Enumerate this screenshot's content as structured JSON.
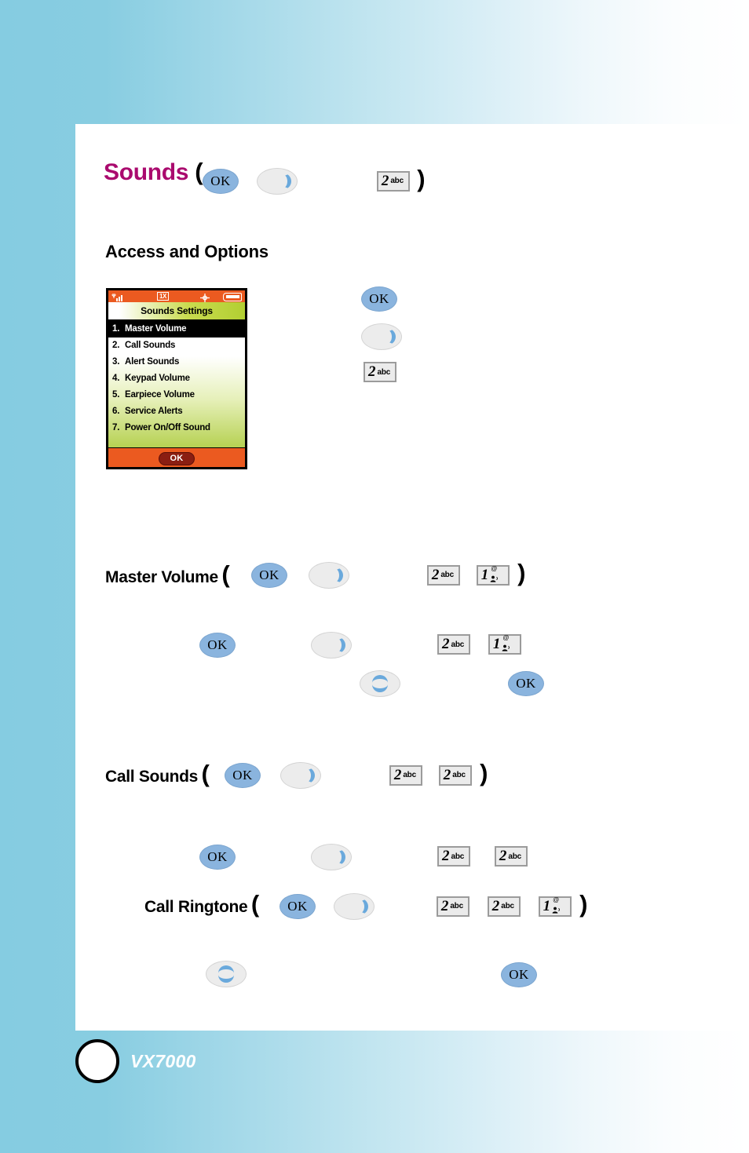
{
  "page": {
    "model": "VX7000",
    "page_badge": "",
    "brand_accent": "#aa0a6e",
    "background_accent": "#85cce1"
  },
  "section": {
    "title": "Sounds",
    "open_paren": "(",
    "close_paren": ")",
    "subtitle": "Access and Options"
  },
  "keys": {
    "ok": "OK",
    "nav_right": "nav-right-key",
    "nav_updown": "nav-up-down-key",
    "key2_digit": "2",
    "key2_letters": "abc",
    "key1_digit": "1",
    "key1_symbol": "@"
  },
  "phone_screen": {
    "status": {
      "signal": "signal-bars",
      "network": "1X",
      "location": "gps-crosshair",
      "battery": "battery-full"
    },
    "title": "Sounds Settings",
    "items": [
      {
        "num": "1.",
        "label": "Master Volume",
        "selected": true
      },
      {
        "num": "2.",
        "label": "Call Sounds",
        "selected": false
      },
      {
        "num": "3.",
        "label": "Alert Sounds",
        "selected": false
      },
      {
        "num": "4.",
        "label": "Keypad Volume",
        "selected": false
      },
      {
        "num": "5.",
        "label": "Earpiece Volume",
        "selected": false
      },
      {
        "num": "6.",
        "label": "Service Alerts",
        "selected": false
      },
      {
        "num": "7.",
        "label": "Power On/Off Sound",
        "selected": false
      }
    ],
    "softkey": "OK"
  },
  "sequences": {
    "master_volume": {
      "label": "Master Volume",
      "open": "(",
      "close": ")"
    },
    "call_sounds": {
      "label": "Call Sounds",
      "open": "(",
      "close": ")"
    },
    "call_ringtone": {
      "label": "Call Ringtone",
      "open": "(",
      "close": ")"
    }
  }
}
